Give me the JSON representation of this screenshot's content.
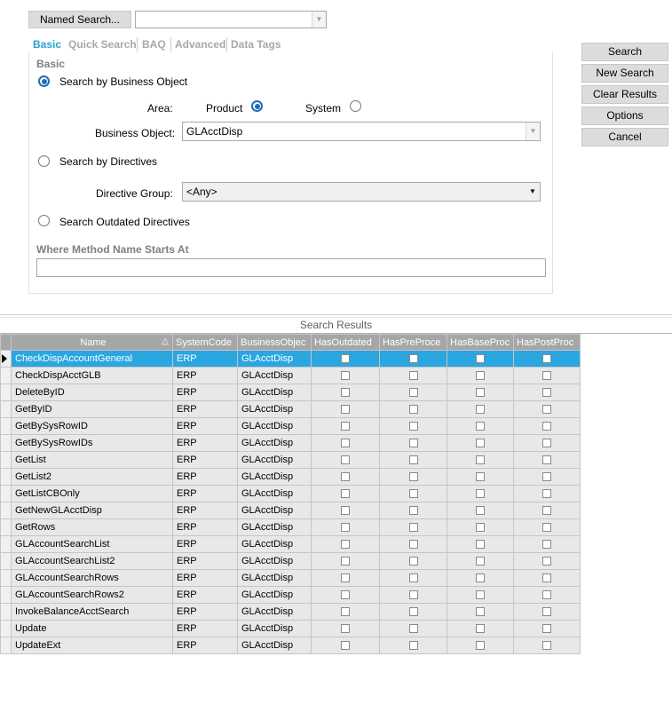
{
  "named_search": {
    "button_label": "Named Search...",
    "value": ""
  },
  "tabs": [
    {
      "label": "Basic",
      "active": true
    },
    {
      "label": "Quick Search",
      "active": false
    },
    {
      "label": "BAQ",
      "active": false
    },
    {
      "label": "Advanced",
      "active": false
    },
    {
      "label": "Data Tags",
      "active": false
    }
  ],
  "panel": {
    "title": "Basic",
    "search_by_business_object": {
      "label": "Search by Business Object",
      "selected": true
    },
    "area": {
      "label": "Area:",
      "product_label": "Product",
      "system_label": "System",
      "selected": "Product"
    },
    "business_object": {
      "label": "Business Object:",
      "value": "GLAcctDisp"
    },
    "search_by_directives": {
      "label": "Search by Directives",
      "selected": false
    },
    "directive_group": {
      "label": "Directive Group:",
      "value": "<Any>"
    },
    "search_outdated": {
      "label": "Search Outdated Directives",
      "selected": false
    },
    "method_name": {
      "label": "Where Method Name Starts At",
      "value": ""
    }
  },
  "actions": {
    "search": "Search",
    "new_search": "New Search",
    "clear_results": "Clear Results",
    "options": "Options",
    "cancel": "Cancel"
  },
  "results": {
    "title": "Search Results",
    "columns": [
      "Name",
      "SystemCode",
      "BusinessObjec",
      "HasOutdated",
      "HasPreProce",
      "HasBaseProc",
      "HasPostProc"
    ],
    "sort_indicator": "△",
    "rows": [
      {
        "name": "CheckDispAccountGeneral",
        "system": "ERP",
        "bo": "GLAcctDisp",
        "selected": true
      },
      {
        "name": "CheckDispAcctGLB",
        "system": "ERP",
        "bo": "GLAcctDisp"
      },
      {
        "name": "DeleteByID",
        "system": "ERP",
        "bo": "GLAcctDisp"
      },
      {
        "name": "GetByID",
        "system": "ERP",
        "bo": "GLAcctDisp"
      },
      {
        "name": "GetBySysRowID",
        "system": "ERP",
        "bo": "GLAcctDisp"
      },
      {
        "name": "GetBySysRowIDs",
        "system": "ERP",
        "bo": "GLAcctDisp"
      },
      {
        "name": "GetList",
        "system": "ERP",
        "bo": "GLAcctDisp"
      },
      {
        "name": "GetList2",
        "system": "ERP",
        "bo": "GLAcctDisp"
      },
      {
        "name": "GetListCBOnly",
        "system": "ERP",
        "bo": "GLAcctDisp"
      },
      {
        "name": "GetNewGLAcctDisp",
        "system": "ERP",
        "bo": "GLAcctDisp"
      },
      {
        "name": "GetRows",
        "system": "ERP",
        "bo": "GLAcctDisp"
      },
      {
        "name": "GLAccountSearchList",
        "system": "ERP",
        "bo": "GLAcctDisp"
      },
      {
        "name": "GLAccountSearchList2",
        "system": "ERP",
        "bo": "GLAcctDisp"
      },
      {
        "name": "GLAccountSearchRows",
        "system": "ERP",
        "bo": "GLAcctDisp"
      },
      {
        "name": "GLAccountSearchRows2",
        "system": "ERP",
        "bo": "GLAcctDisp"
      },
      {
        "name": "InvokeBalanceAcctSearch",
        "system": "ERP",
        "bo": "GLAcctDisp"
      },
      {
        "name": "Update",
        "system": "ERP",
        "bo": "GLAcctDisp"
      },
      {
        "name": "UpdateExt",
        "system": "ERP",
        "bo": "GLAcctDisp"
      }
    ]
  },
  "colors": {
    "accent": "#2aa0d4",
    "selected_row": "#2aa6e0",
    "header_bg": "#a6a6a6",
    "radio": "#1f6db5"
  }
}
